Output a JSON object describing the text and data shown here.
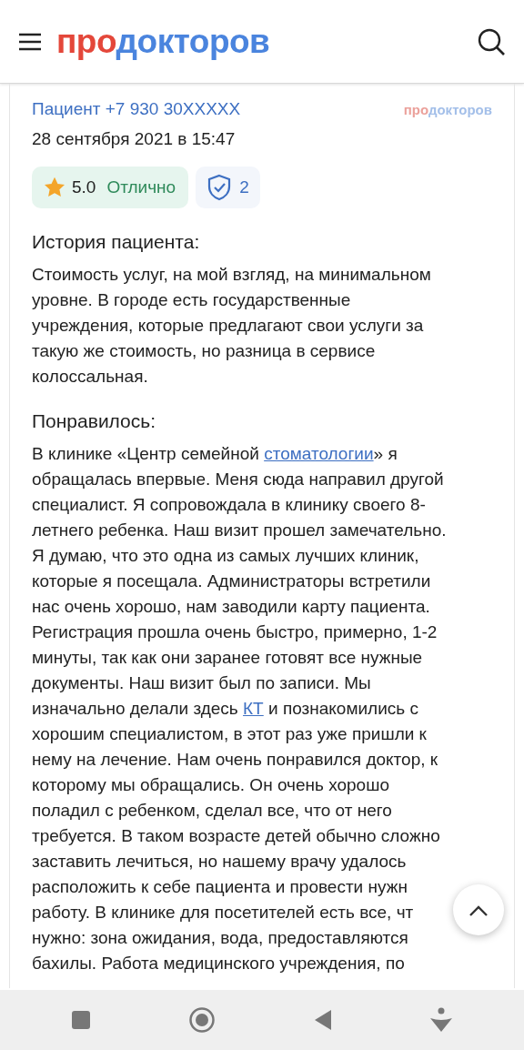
{
  "header": {
    "logo": [
      {
        "text": "про",
        "color": "#e4473a"
      },
      {
        "text": "докторов",
        "color": "#4a84de"
      }
    ]
  },
  "review": {
    "author": "Пациент +7 930 30XXXXX",
    "date": "28 сентября 2021 в 15:47",
    "source_logo": [
      {
        "text": "про",
        "color": "#eba19b"
      },
      {
        "text": "докторов",
        "color": "#a3bfe9"
      }
    ],
    "rating": {
      "score": "5.0",
      "verdict": "Отлично"
    },
    "verified_count": "2",
    "sections": [
      {
        "heading": "История пациента:",
        "lines": [
          [
            {
              "kind": "text",
              "text": "Стоимость услуг, на мой взгляд, на минимальном"
            }
          ],
          [
            {
              "kind": "text",
              "text": "уровне. В городе есть государственные"
            }
          ],
          [
            {
              "kind": "text",
              "text": "учреждения, которые предлагают свои услуги за"
            }
          ],
          [
            {
              "kind": "text",
              "text": "такую же стоимость, но разница в сервисе"
            }
          ],
          [
            {
              "kind": "text",
              "text": "колоссальная."
            }
          ]
        ]
      },
      {
        "heading": "Понравилось:",
        "lines": [
          [
            {
              "kind": "text",
              "text": "В клинике «Центр семейной "
            },
            {
              "kind": "link",
              "text": "стоматологии"
            },
            {
              "kind": "text",
              "text": "» я"
            }
          ],
          [
            {
              "kind": "text",
              "text": "обращалась впервые. Меня сюда направил другой"
            }
          ],
          [
            {
              "kind": "text",
              "text": "специалист. Я сопровождала в клинику своего 8-"
            }
          ],
          [
            {
              "kind": "text",
              "text": "летнего ребенка. Наш визит прошел замечательно."
            }
          ],
          [
            {
              "kind": "text",
              "text": "Я думаю, что это одна из самых лучших клиник,"
            }
          ],
          [
            {
              "kind": "text",
              "text": "которые я посещала. Администраторы встретили"
            }
          ],
          [
            {
              "kind": "text",
              "text": "нас очень хорошо, нам заводили карту пациента."
            }
          ],
          [
            {
              "kind": "text",
              "text": "Регистрация прошла очень быстро, примерно, 1-2"
            }
          ],
          [
            {
              "kind": "text",
              "text": "минуты, так как они заранее готовят все нужные"
            }
          ],
          [
            {
              "kind": "text",
              "text": "документы. Наш визит был по записи. Мы"
            }
          ],
          [
            {
              "kind": "text",
              "text": "изначально делали здесь "
            },
            {
              "kind": "link",
              "text": "КТ"
            },
            {
              "kind": "text",
              "text": " и познакомились с"
            }
          ],
          [
            {
              "kind": "text",
              "text": "хорошим специалистом, в этот раз уже пришли к"
            }
          ],
          [
            {
              "kind": "text",
              "text": "нему на лечение. Нам очень понравился доктор, к"
            }
          ],
          [
            {
              "kind": "text",
              "text": "которому мы обращались. Он очень хорошо"
            }
          ],
          [
            {
              "kind": "text",
              "text": "поладил с ребенком, сделал все, что от него"
            }
          ],
          [
            {
              "kind": "text",
              "text": "требуется. В таком возрасте детей обычно сложно"
            }
          ],
          [
            {
              "kind": "text",
              "text": "заставить лечиться, но нашему врачу удалось"
            }
          ],
          [
            {
              "kind": "text",
              "text": "расположить к себе пациента и провести нужн"
            }
          ],
          [
            {
              "kind": "text",
              "text": "работу. В клинике для посетителей есть все, чт"
            }
          ],
          [
            {
              "kind": "text",
              "text": "нужно: зона ожидания, вода, предоставляются"
            }
          ],
          [
            {
              "kind": "text",
              "text": "бахилы. Работа медицинского учреждения, по"
            }
          ]
        ]
      }
    ]
  }
}
